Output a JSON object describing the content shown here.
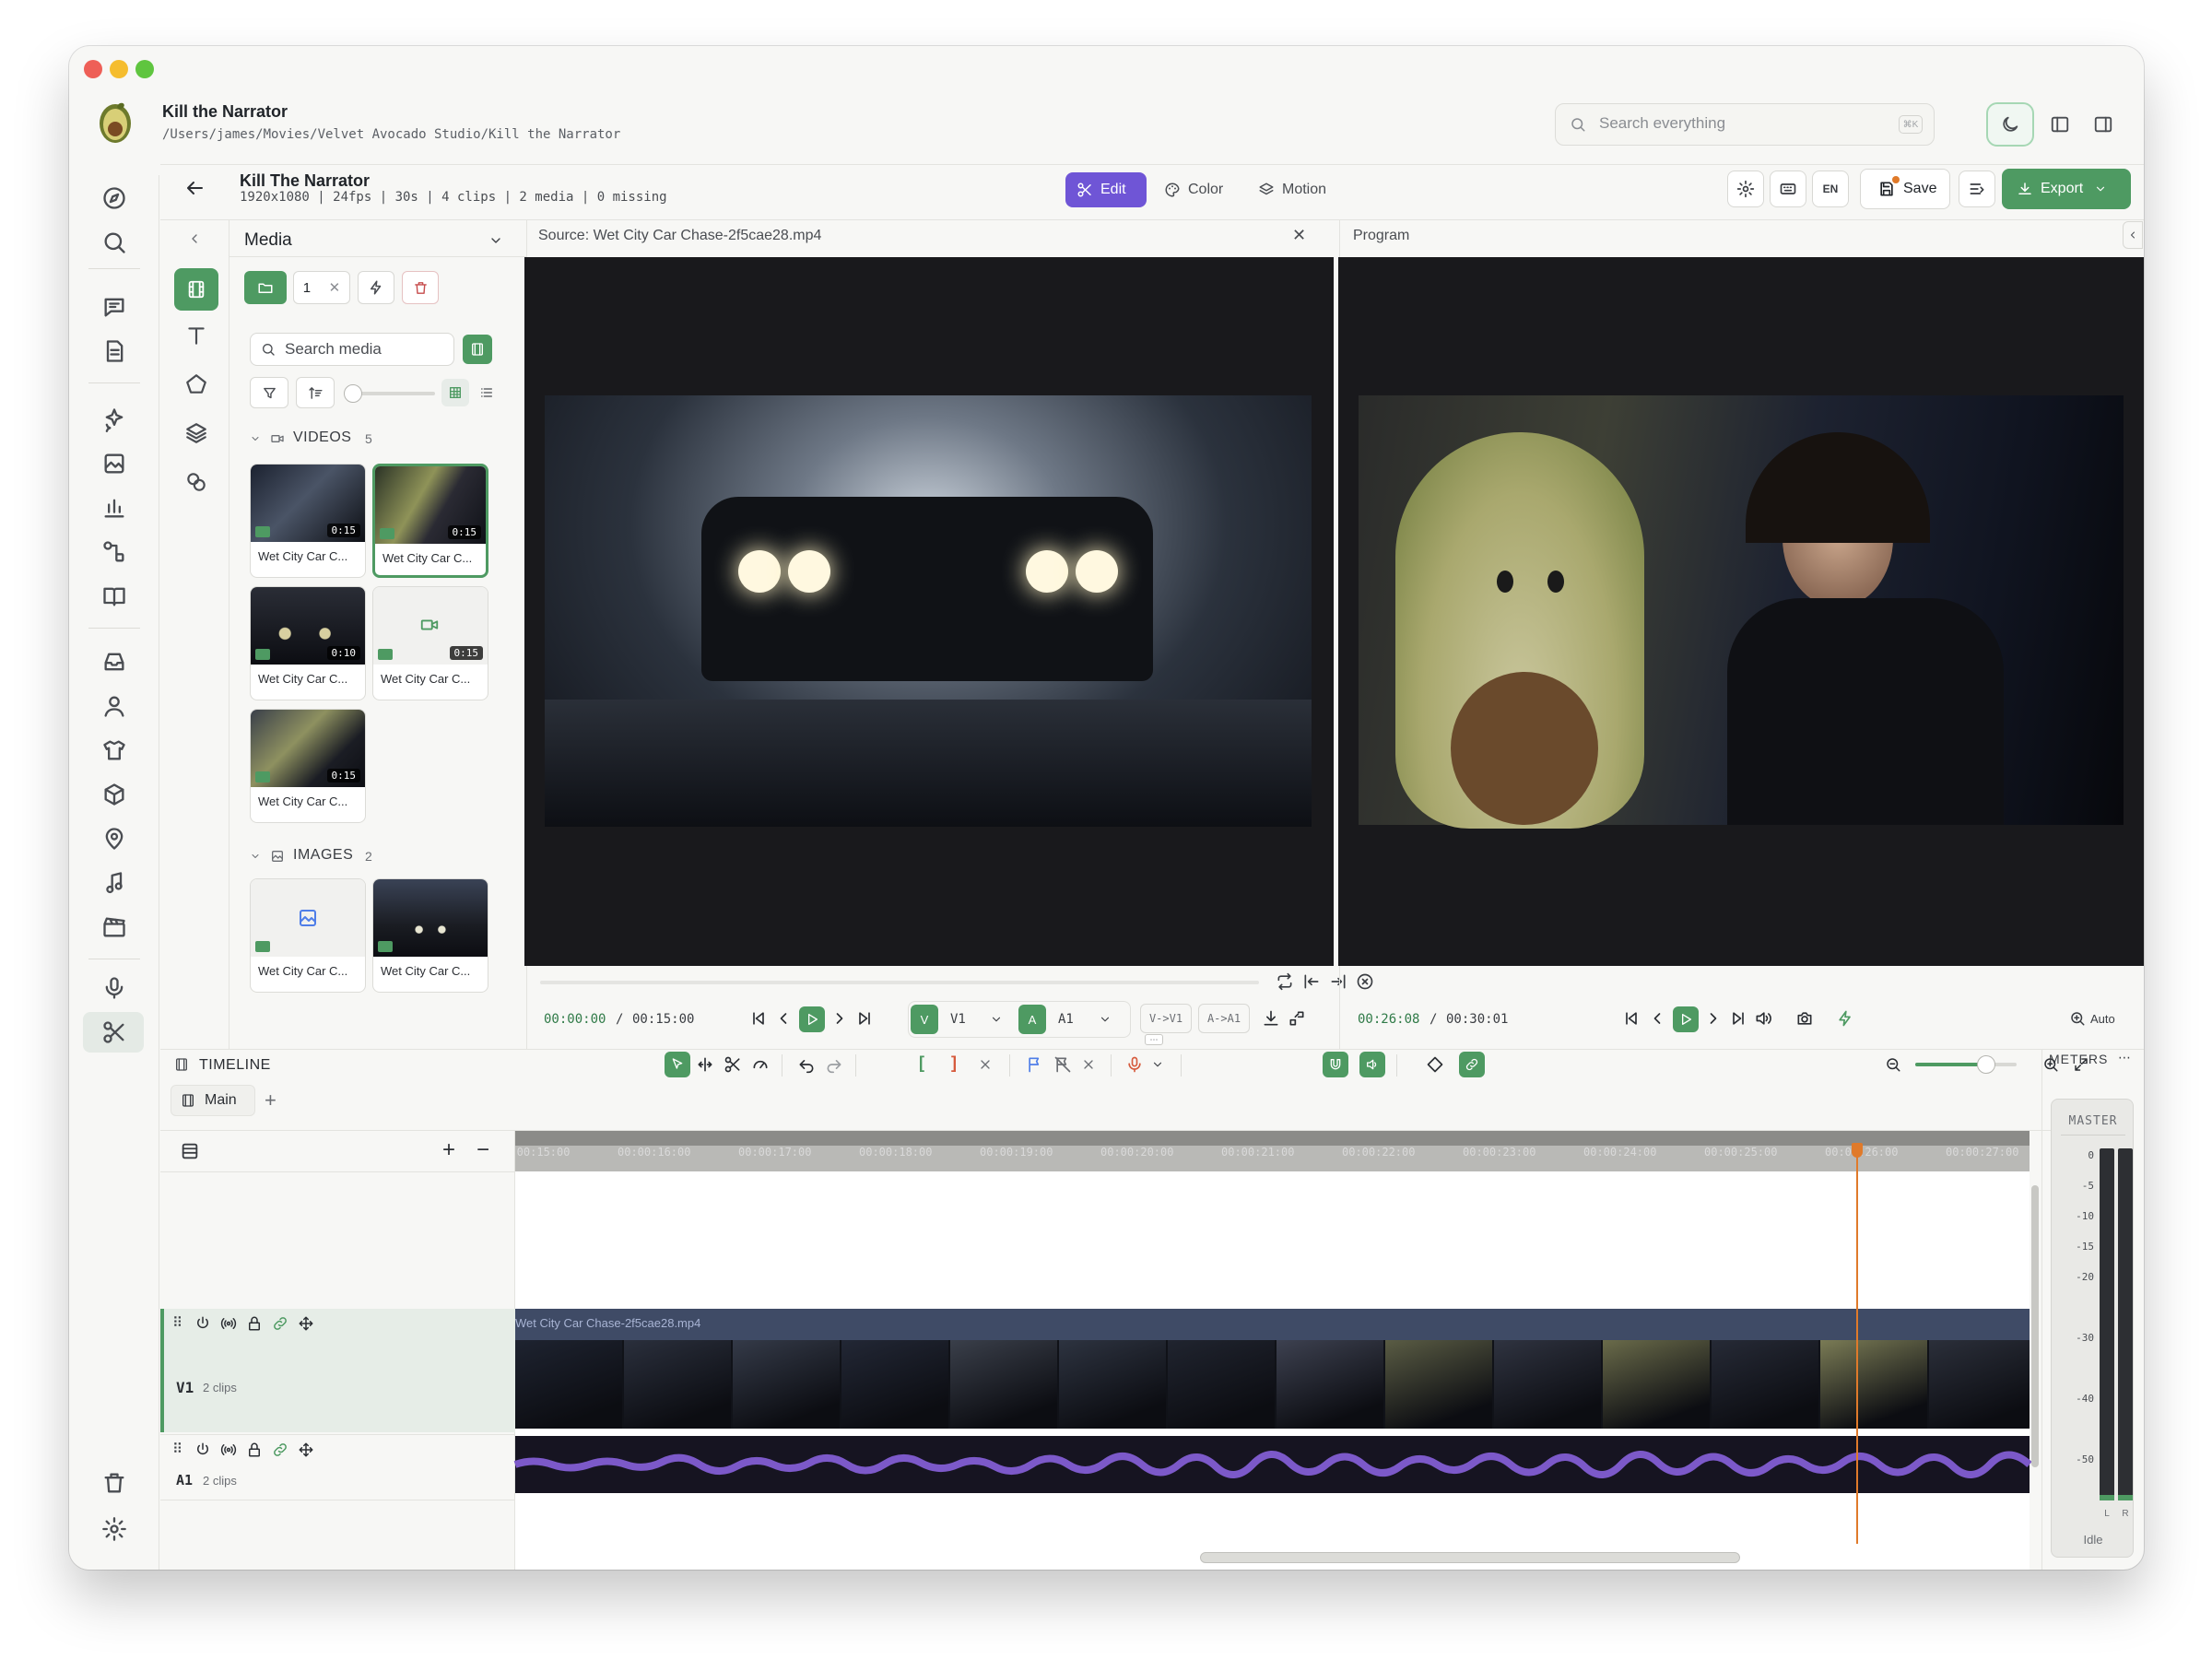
{
  "app": {
    "title": "Kill the Narrator",
    "path": "/Users/james/Movies/Velvet Avocado Studio/Kill the Narrator",
    "search_placeholder": "Search everything",
    "search_shortcut": "⌘K"
  },
  "project": {
    "title": "Kill The Narrator",
    "meta": "1920x1080 | 24fps | 30s | 4 clips | 2 media | 0 missing"
  },
  "modes": {
    "edit": "Edit",
    "color": "Color",
    "motion": "Motion"
  },
  "toolbar": {
    "lang": "EN",
    "save": "Save",
    "export": "Export"
  },
  "media": {
    "panel_title": "Media",
    "counter": "1",
    "search_placeholder": "Search media",
    "videos_label": "VIDEOS",
    "videos_count": "5",
    "images_label": "IMAGES",
    "images_count": "2",
    "videos": [
      {
        "label": "Wet City Car C...",
        "duration": "0:15"
      },
      {
        "label": "Wet City Car C...",
        "duration": "0:15"
      },
      {
        "label": "Wet City Car C...",
        "duration": "0:10"
      },
      {
        "label": "Wet City Car C...",
        "duration": "0:15"
      },
      {
        "label": "Wet City Car C...",
        "duration": "0:15"
      }
    ],
    "images": [
      {
        "label": "Wet City Car C..."
      },
      {
        "label": "Wet City Car C..."
      }
    ]
  },
  "source": {
    "title": "Source: Wet City Car Chase-2f5cae28.mp4",
    "timecode": "00:00:00",
    "duration": "00:15:00",
    "v_track_btn": "V",
    "v_track": "V1",
    "a_track_btn": "A",
    "a_track": "A1",
    "v_to_v": "V->V1",
    "a_to_a": "A->A1"
  },
  "program": {
    "title": "Program",
    "timecode": "00:26:08",
    "duration": "00:30:01",
    "zoom": "Auto"
  },
  "timeline": {
    "title": "TIMELINE",
    "sequence_tab": "Main",
    "meters_label": "METERS",
    "master_label": "MASTER",
    "meter_state": "Idle",
    "meter_scale": [
      "0",
      "-5",
      "-10",
      "-15",
      "-20",
      "-30",
      "-40",
      "-50"
    ],
    "meter_channels": [
      "L",
      "R"
    ],
    "ruler": [
      "00:00:15:00",
      "00:00:16:00",
      "00:00:17:00",
      "00:00:18:00",
      "00:00:19:00",
      "00:00:20:00",
      "00:00:21:00",
      "00:00:22:00",
      "00:00:23:00",
      "00:00:24:00",
      "00:00:25:00",
      "00:00:26:00",
      "00:00:27:00"
    ],
    "tracks": [
      {
        "name": "V1",
        "clips": "2 clips",
        "clip_label": "Wet City Car Chase-2f5cae28.mp4"
      },
      {
        "name": "A1",
        "clips": "2 clips"
      }
    ],
    "zoom_level": 0.7,
    "playhead_time": "00:00:26:00"
  },
  "colors": {
    "accent_green": "#4e9a62",
    "edit_purple": "#6f55d6",
    "playhead": "#e07a2a",
    "audio_purple": "#7c59c9"
  }
}
